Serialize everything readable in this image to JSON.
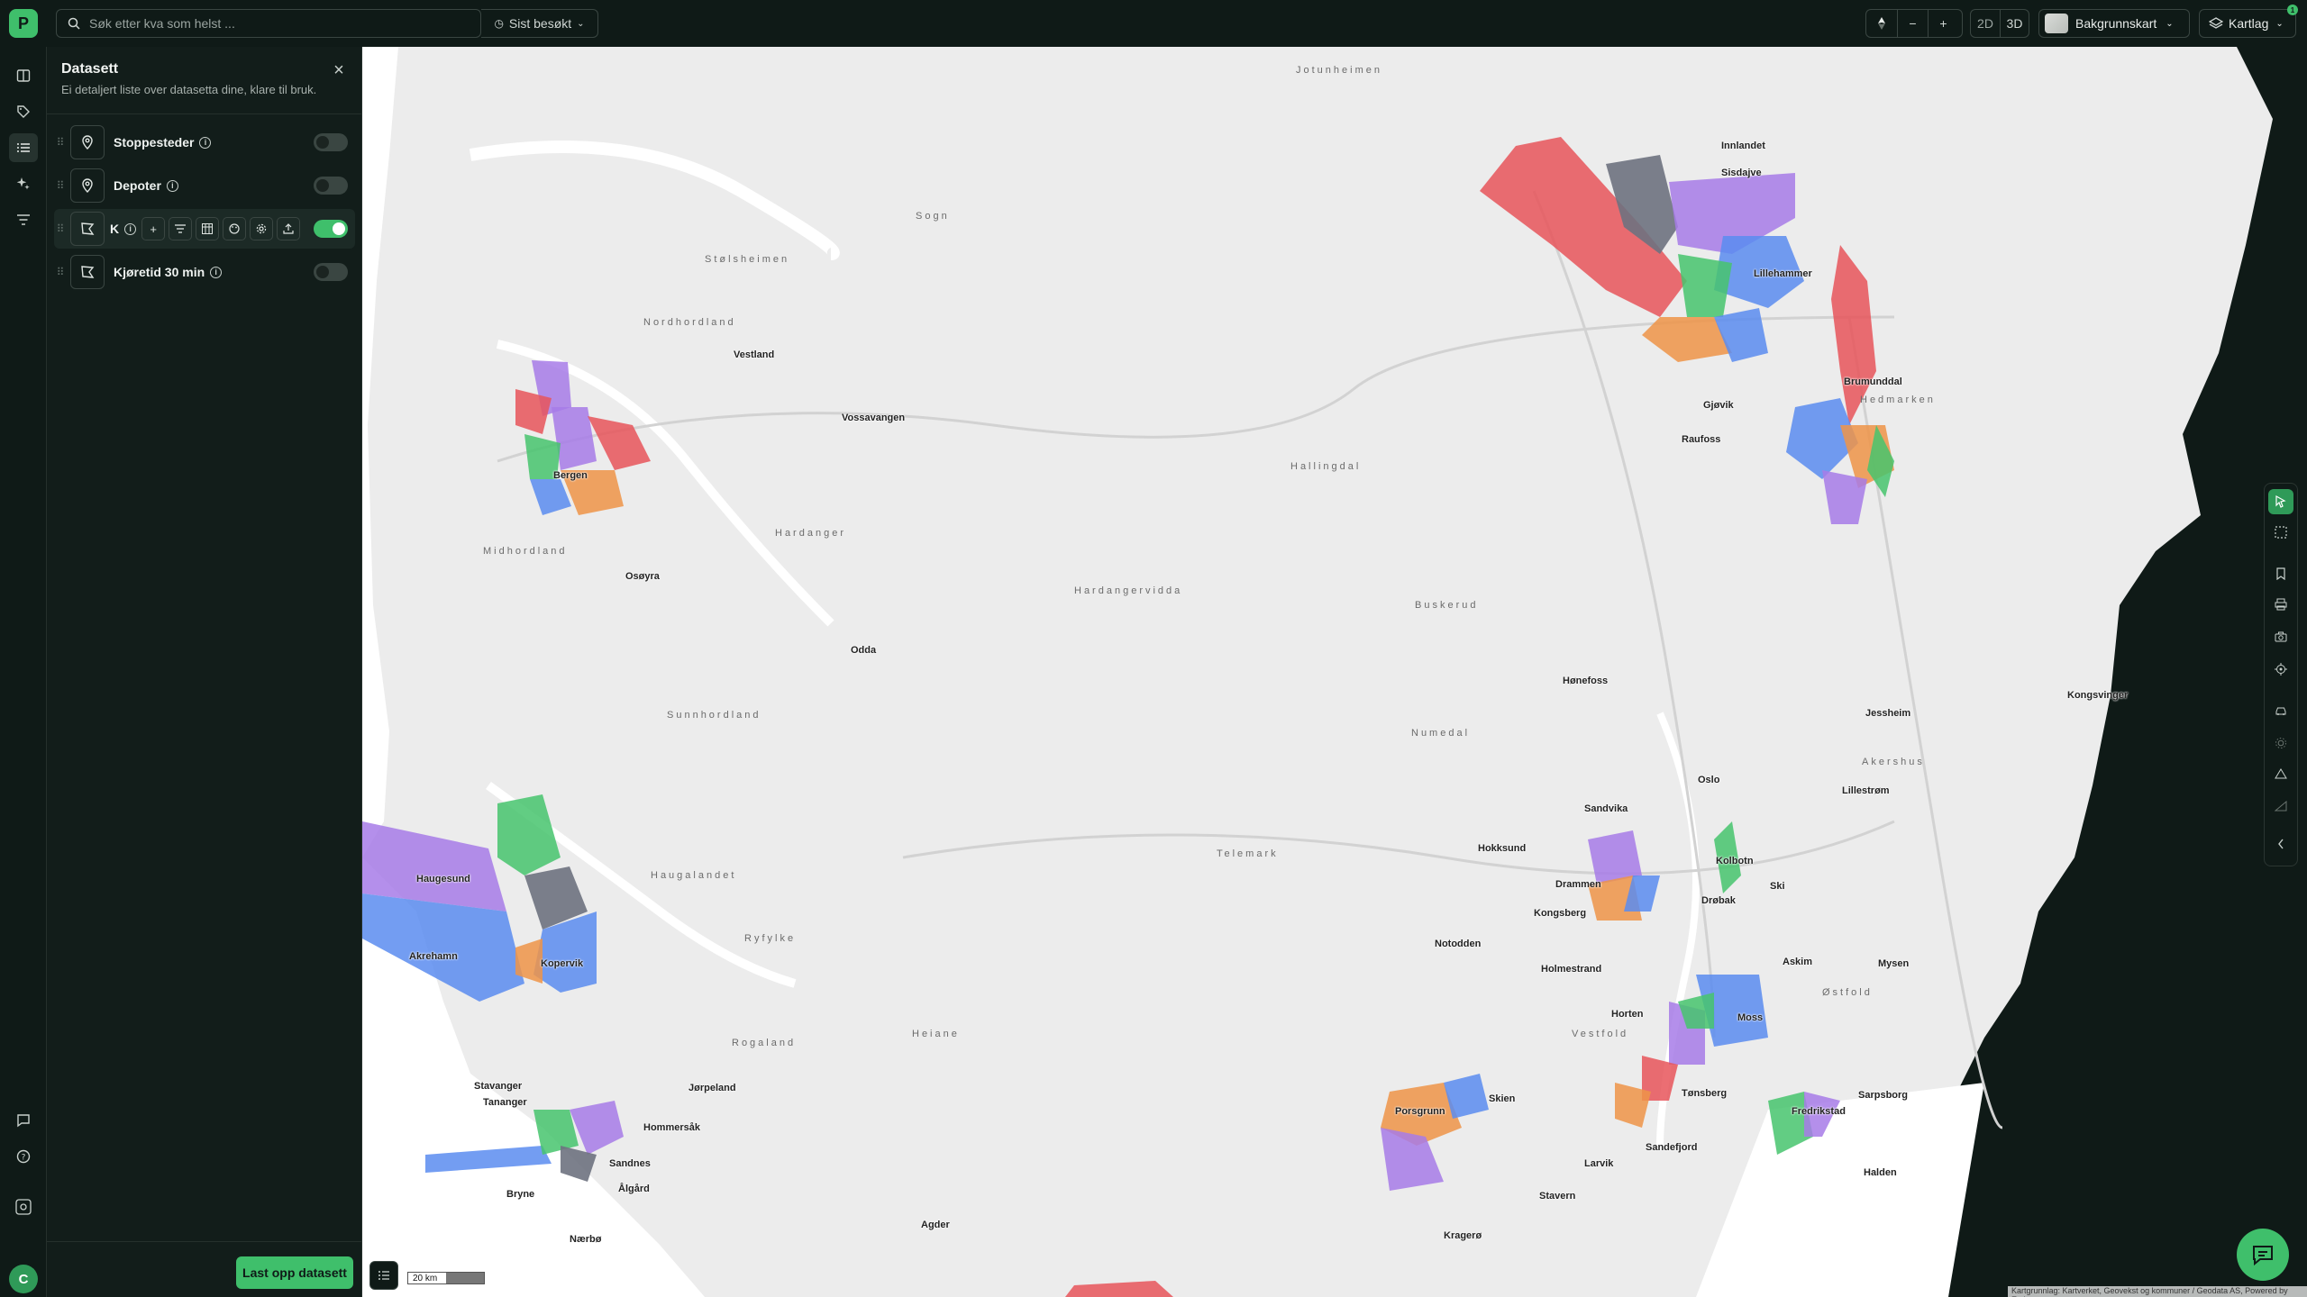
{
  "topbar": {
    "search_placeholder": "Søk etter kva som helst ...",
    "recent_label": "Sist besøkt",
    "zoom_out": "−",
    "zoom_in": "+",
    "mode_2d": "2D",
    "mode_3d": "3D",
    "basemap_label": "Bakgrunnskart",
    "layers_label": "Kartlag",
    "layers_badge": "1"
  },
  "panel": {
    "title": "Datasett",
    "subtitle": "Ei detaljert liste over datasetta dine, klare til bruk.",
    "datasets": [
      {
        "label": "Stoppesteder",
        "icon": "location-pin-icon",
        "enabled": false
      },
      {
        "label": "Depoter",
        "icon": "location-pin-icon",
        "enabled": false
      },
      {
        "label": "K",
        "icon": "polygon-icon",
        "enabled": true
      },
      {
        "label": "Kjøretid 30 min",
        "icon": "polygon-icon",
        "enabled": false
      }
    ],
    "upload_button": "Last opp datasett"
  },
  "user": {
    "initial": "C"
  },
  "map": {
    "scale_label": "20 km",
    "attribution": "Kartgrunnlag: Kartverket, Geovekst og kommuner / Geodata AS, Powered by Esri",
    "places": [
      "Bergen",
      "Osøyra",
      "Odda",
      "Haugesund",
      "Akrehamn",
      "Kopervik",
      "Stavanger",
      "Tananger",
      "Sandnes",
      "Bryne",
      "Nærbø",
      "Jørpeland",
      "Hommersåk",
      "Ålgård",
      "Agder",
      "Vossavangen",
      "Vestland",
      "Gjøvik",
      "Raufoss",
      "Lillehammer",
      "Brumunddal",
      "Innlandet",
      "Sisdajve",
      "Hønefoss",
      "Oslo",
      "Sandvika",
      "Drammen",
      "Kongsberg",
      "Hokksund",
      "Notodden",
      "Holmestrand",
      "Horten",
      "Tønsberg",
      "Sandefjord",
      "Larvik",
      "Stavern",
      "Skien",
      "Porsgrunn",
      "Kragerø",
      "Moss",
      "Drøbak",
      "Ski",
      "Askim",
      "Mysen",
      "Fredrikstad",
      "Sarpsborg",
      "Halden",
      "Jessheim",
      "Lillestrøm",
      "Kongsvinger",
      "Kolbotn"
    ],
    "regions": [
      "Sogn",
      "Stølsheimen",
      "Nordhordland",
      "Midhordland",
      "Hardanger",
      "Sunnhordland",
      "Haugalandet",
      "Ryfylke",
      "Rogaland",
      "Heiane",
      "Hardangervidda",
      "Hallingdal",
      "Numedal",
      "Telemark",
      "Buskerud",
      "Jotunheimen",
      "Hedmarken",
      "Vestfold",
      "Østfold",
      "Akershus"
    ]
  },
  "colors": {
    "accent": "#3fbf6b",
    "zone_red": "#e8555b",
    "zone_purple": "#a77be8",
    "zone_blue": "#5b8cf0",
    "zone_green": "#46c46d",
    "zone_orange": "#ef9448",
    "zone_gray": "#6e7280"
  }
}
